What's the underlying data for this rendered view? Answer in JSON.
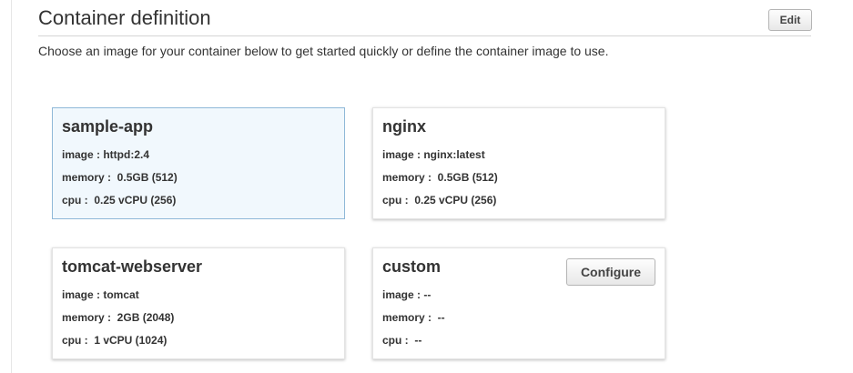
{
  "section": {
    "title": "Container definition",
    "edit_label": "Edit",
    "description": "Choose an image for your container below to get started quickly or define the container image to use."
  },
  "cards": [
    {
      "name": "sample-app",
      "image": "image : httpd:2.4",
      "memory": "memory :  0.5GB (512)",
      "cpu": "cpu :  0.25 vCPU (256)",
      "selected": true
    },
    {
      "name": "nginx",
      "image": "image : nginx:latest",
      "memory": "memory :  0.5GB (512)",
      "cpu": "cpu :  0.25 vCPU (256)",
      "selected": false
    },
    {
      "name": "tomcat-webserver",
      "image": "image : tomcat",
      "memory": "memory :  2GB (2048)",
      "cpu": "cpu :  1 vCPU (1024)",
      "selected": false
    },
    {
      "name": "custom",
      "image": "image : --",
      "memory": "memory :  --",
      "cpu": "cpu :  --",
      "configure_label": "Configure",
      "selected": false
    }
  ],
  "colors": {
    "selected_background": "#f1f8fd",
    "selected_border": "#8fb8d8",
    "text": "#333333"
  }
}
